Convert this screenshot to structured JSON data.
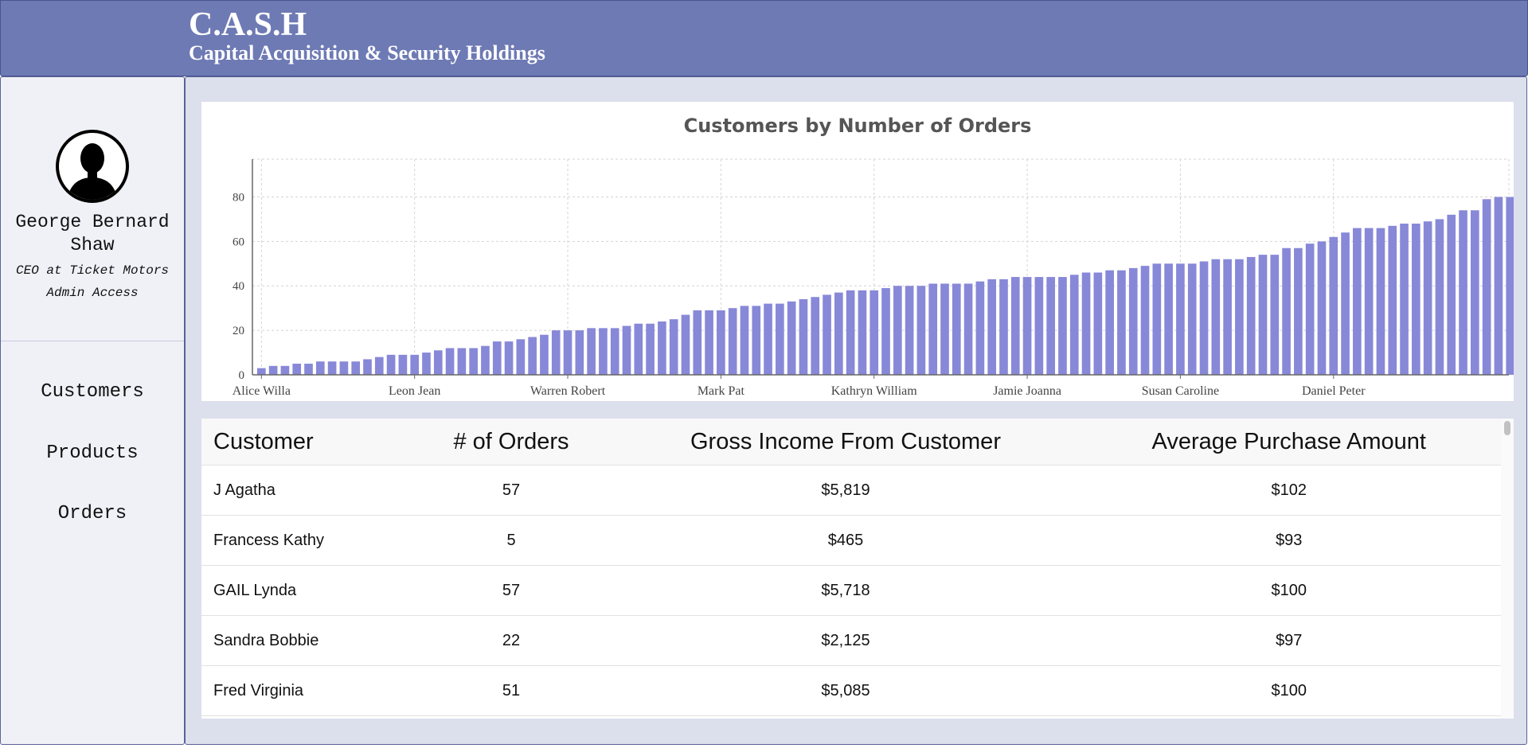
{
  "header": {
    "title": "C.A.S.H",
    "subtitle": "Capital Acquisition & Security Holdings"
  },
  "user": {
    "name": "George Bernard Shaw",
    "role": "CEO at Ticket Motors",
    "access": "Admin Access"
  },
  "nav": {
    "items": [
      {
        "label": "Customers"
      },
      {
        "label": "Products"
      },
      {
        "label": "Orders"
      }
    ]
  },
  "chart_data": {
    "type": "bar",
    "title": "Customers by Number of Orders",
    "xlabel": "",
    "ylabel": "",
    "ylim": [
      0,
      97
    ],
    "yticks": [
      0,
      20,
      40,
      60,
      80
    ],
    "grid": true,
    "color": "#8888d8",
    "categories": [
      "Alice Willa",
      "Leon Jean",
      "Warren Robert",
      "Mark Pat",
      "Kathryn William",
      "Jamie Joanna",
      "Susan Caroline",
      "Daniel Peter"
    ],
    "category_bar_index": [
      0,
      13,
      26,
      39,
      52,
      65,
      78,
      91
    ],
    "values": [
      3,
      4,
      4,
      5,
      5,
      6,
      6,
      6,
      6,
      7,
      8,
      9,
      9,
      9,
      10,
      11,
      12,
      12,
      12,
      13,
      15,
      15,
      16,
      17,
      18,
      20,
      20,
      20,
      21,
      21,
      21,
      22,
      23,
      23,
      24,
      25,
      27,
      29,
      29,
      29,
      30,
      31,
      31,
      32,
      32,
      33,
      34,
      35,
      36,
      37,
      38,
      38,
      38,
      39,
      40,
      40,
      40,
      41,
      41,
      41,
      41,
      42,
      43,
      43,
      44,
      44,
      44,
      44,
      44,
      45,
      46,
      46,
      47,
      47,
      48,
      49,
      50,
      50,
      50,
      50,
      51,
      52,
      52,
      52,
      53,
      54,
      54,
      57,
      57,
      59,
      60,
      62,
      64,
      66,
      66,
      66,
      67,
      68,
      68,
      69,
      70,
      72,
      74,
      74,
      79,
      80,
      80
    ]
  },
  "table": {
    "headers": [
      "Customer",
      "# of Orders",
      "Gross Income From Customer",
      "Average Purchase Amount"
    ],
    "rows": [
      {
        "customer": "J Agatha",
        "orders": "57",
        "gross": "$5,819",
        "avg": "$102"
      },
      {
        "customer": "Francess Kathy",
        "orders": "5",
        "gross": "$465",
        "avg": "$93"
      },
      {
        "customer": "GAIL Lynda",
        "orders": "57",
        "gross": "$5,718",
        "avg": "$100"
      },
      {
        "customer": "Sandra Bobbie",
        "orders": "22",
        "gross": "$2,125",
        "avg": "$97"
      },
      {
        "customer": "Fred Virginia",
        "orders": "51",
        "gross": "$5,085",
        "avg": "$100"
      }
    ]
  },
  "colors": {
    "header_bg": "#6e7ab4",
    "sidebar_bg": "#f0f1f7",
    "main_bg": "#dcdfec",
    "bar": "#8888d8"
  }
}
